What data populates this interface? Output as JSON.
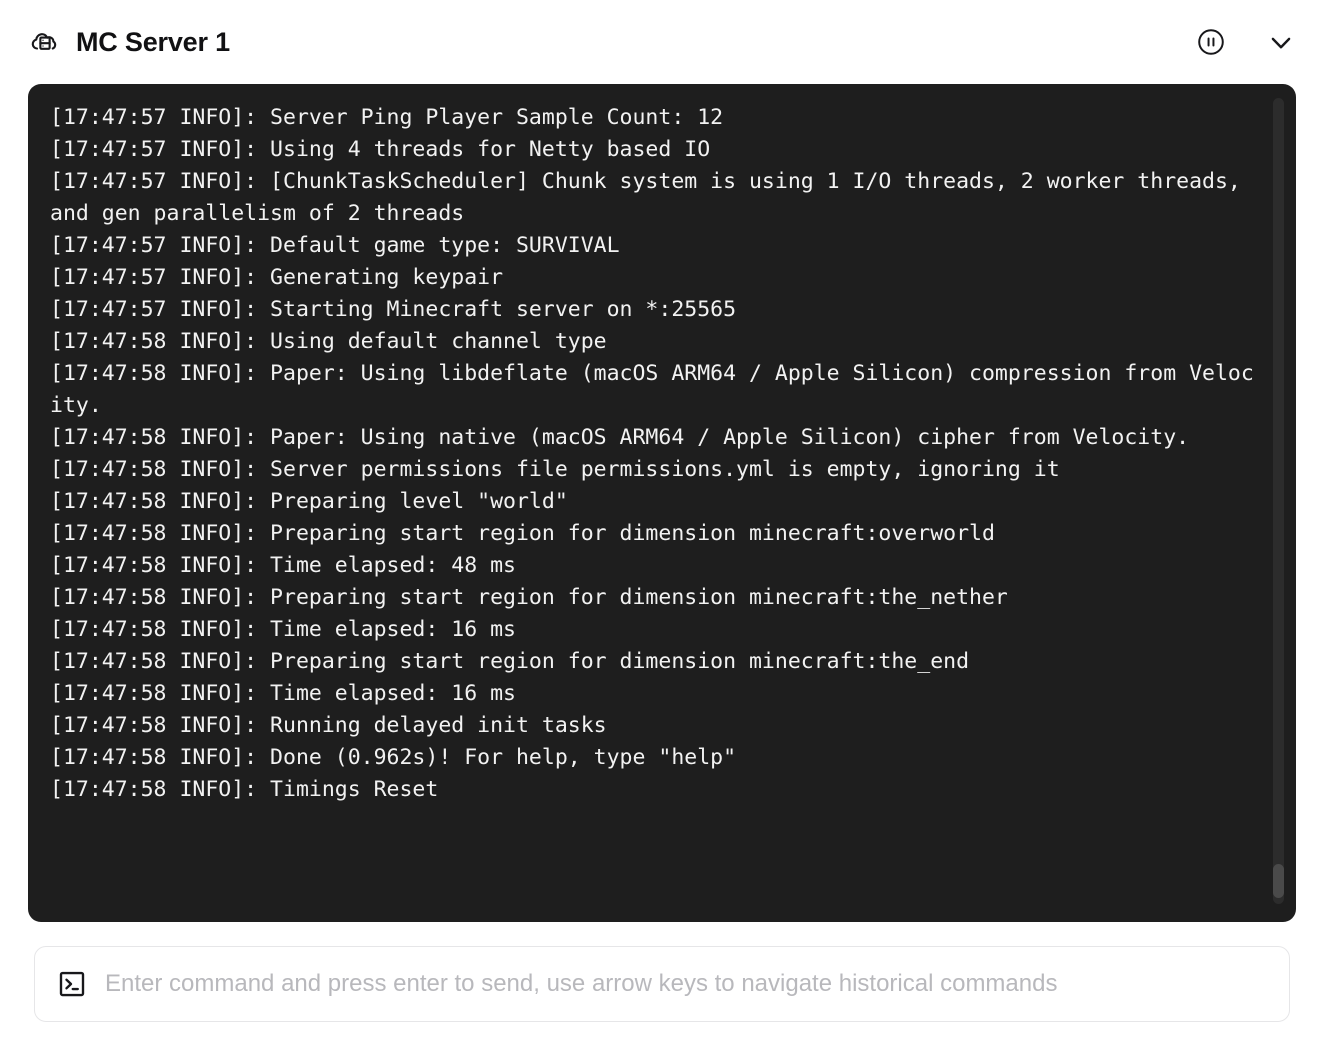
{
  "header": {
    "title": "MC Server 1",
    "icon": "cloud-server-icon",
    "pause_button_label": "Pause",
    "pause_icon": "pause-circle-icon",
    "collapse_button_label": "Collapse",
    "collapse_icon": "chevron-down-icon"
  },
  "terminal": {
    "background_color": "#1e1e1e",
    "text_color": "#f2f2f2",
    "scrollbar": {
      "track_color": "#2c2c2c",
      "thumb_color": "#4a4a4a",
      "thumb_position": "near-bottom"
    },
    "log_lines": [
      "[17:47:57 INFO]: Server Ping Player Sample Count: 12",
      "[17:47:57 INFO]: Using 4 threads for Netty based IO",
      "[17:47:57 INFO]: [ChunkTaskScheduler] Chunk system is using 1 I/O threads, 2 worker threads, and gen parallelism of 2 threads",
      "[17:47:57 INFO]: Default game type: SURVIVAL",
      "[17:47:57 INFO]: Generating keypair",
      "[17:47:57 INFO]: Starting Minecraft server on *:25565",
      "[17:47:58 INFO]: Using default channel type",
      "[17:47:58 INFO]: Paper: Using libdeflate (macOS ARM64 / Apple Silicon) compression from Velocity.",
      "[17:47:58 INFO]: Paper: Using native (macOS ARM64 / Apple Silicon) cipher from Velocity.",
      "[17:47:58 INFO]: Server permissions file permissions.yml is empty, ignoring it",
      "[17:47:58 INFO]: Preparing level \"world\"",
      "[17:47:58 INFO]: Preparing start region for dimension minecraft:overworld",
      "[17:47:58 INFO]: Time elapsed: 48 ms",
      "[17:47:58 INFO]: Preparing start region for dimension minecraft:the_nether",
      "[17:47:58 INFO]: Time elapsed: 16 ms",
      "[17:47:58 INFO]: Preparing start region for dimension minecraft:the_end",
      "[17:47:58 INFO]: Time elapsed: 16 ms",
      "[17:47:58 INFO]: Running delayed init tasks",
      "[17:47:58 INFO]: Done (0.962s)! For help, type \"help\"",
      "[17:47:58 INFO]: Timings Reset"
    ]
  },
  "command_bar": {
    "icon": "terminal-prompt-icon",
    "value": "",
    "placeholder": "Enter command and press enter to send, use arrow keys to navigate historical commands"
  }
}
